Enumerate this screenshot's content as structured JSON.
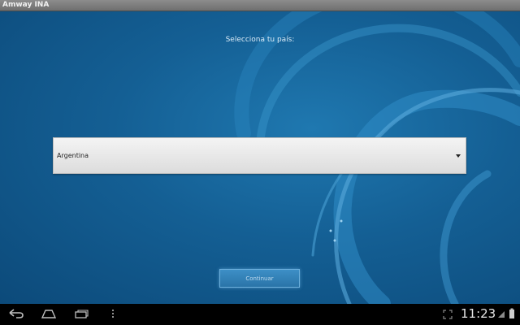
{
  "window": {
    "title": "Amway INA"
  },
  "screen": {
    "prompt": "Selecciona tu país:",
    "country_select": {
      "value": "Argentina"
    },
    "continue_label": "Continuar"
  },
  "system_bar": {
    "time": "11:23",
    "icons": [
      "back-icon",
      "home-icon",
      "recent-apps-icon",
      "menu-icon",
      "fullscreen-icon",
      "signal-icon",
      "battery-icon"
    ]
  },
  "colors": {
    "background": "#145f94",
    "select_bg": "#e8e8e8",
    "button_bg": "#3383b9"
  }
}
